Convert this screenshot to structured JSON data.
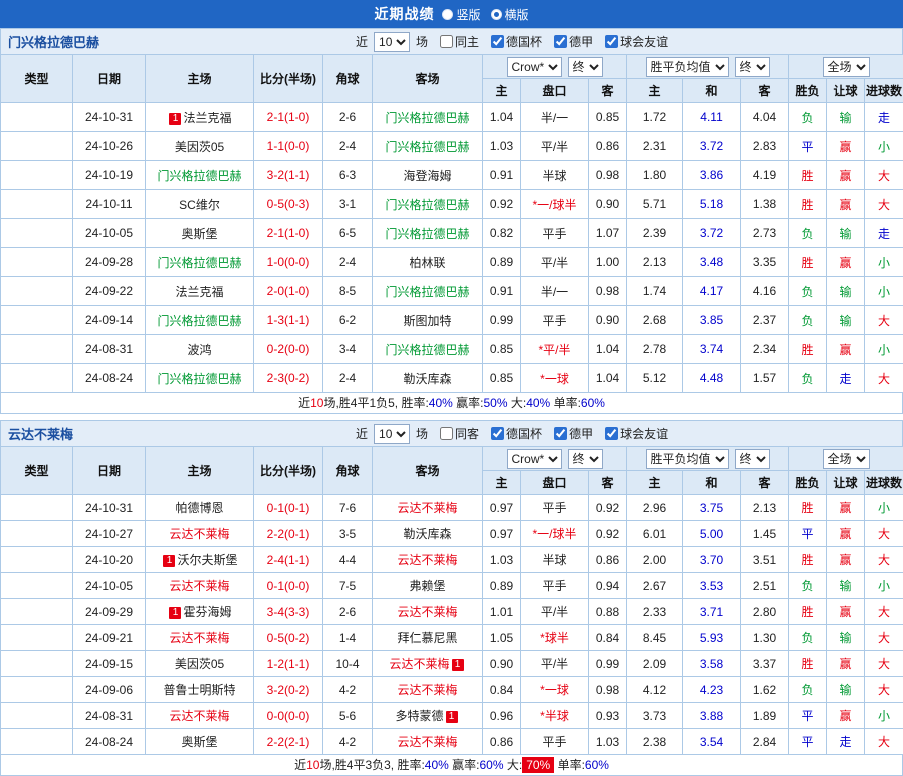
{
  "palette": {
    "topbar_bg": "#2066C4",
    "header_bg": "#DCE9F6",
    "bar_bg": "#E3EDF8",
    "border": "#ACC9E6",
    "red": "#E60012",
    "green": "#009933",
    "blue": "#0000CC",
    "title_blue": "#1B4FA0",
    "league_cup": "#CB4545",
    "league_bund": "#BB44C0",
    "league_friend": "#3AA6A8"
  },
  "top_bar": {
    "title": "近期战绩",
    "options": [
      {
        "label": "竖版",
        "selected": false
      },
      {
        "label": "横版",
        "selected": true
      }
    ]
  },
  "table_header": {
    "type": "类型",
    "date": "日期",
    "home": "主场",
    "score": "比分(半场)",
    "corner": "角球",
    "away": "客场",
    "select_company": "Crow*",
    "select_final": "终",
    "select_avg": "胜平负均值",
    "select_scope": "全场",
    "sub": [
      "主",
      "盘口",
      "客",
      "主",
      "和",
      "客",
      "胜负",
      "让球",
      "进球数"
    ]
  },
  "sections": [
    {
      "title": "门兴格拉德巴赫",
      "filter": {
        "near": "近",
        "count": "10",
        "games": "场",
        "same": "同主",
        "same_checked": false,
        "leagues": [
          {
            "label": "德国杯",
            "checked": true
          },
          {
            "label": "德甲",
            "checked": true
          },
          {
            "label": "球会友谊",
            "checked": true
          }
        ]
      },
      "rows": [
        {
          "league": "德国杯",
          "lg": "cup",
          "date": "24-10-31",
          "home": {
            "name": "法兰克福",
            "badge": "1",
            "badge_pos": "before"
          },
          "score": "2-1(1-0)",
          "corner": "2-6",
          "away": {
            "name": "门兴格拉德巴赫",
            "hl": "green"
          },
          "ah": [
            "1.04",
            "半/一",
            "0.85"
          ],
          "eu": [
            "1.72",
            "4.11",
            "4.04"
          ],
          "res": [
            [
              "负",
              "g"
            ],
            [
              "输",
              "g"
            ],
            [
              "走",
              "b"
            ]
          ]
        },
        {
          "league": "德甲",
          "lg": "bund",
          "date": "24-10-26",
          "home": {
            "name": "美因茨05"
          },
          "score": "1-1(0-0)",
          "corner": "2-4",
          "away": {
            "name": "门兴格拉德巴赫",
            "hl": "green"
          },
          "ah": [
            "1.03",
            "平/半",
            "0.86"
          ],
          "eu": [
            "2.31",
            "3.72",
            "2.83"
          ],
          "res": [
            [
              "平",
              "b"
            ],
            [
              "赢",
              "r"
            ],
            [
              "小",
              "g"
            ]
          ]
        },
        {
          "league": "德甲",
          "lg": "bund",
          "date": "24-10-19",
          "home": {
            "name": "门兴格拉德巴赫",
            "hl": "green"
          },
          "score": "3-2(1-1)",
          "corner": "6-3",
          "away": {
            "name": "海登海姆"
          },
          "ah": [
            "0.91",
            "半球",
            "0.98"
          ],
          "eu": [
            "1.80",
            "3.86",
            "4.19"
          ],
          "res": [
            [
              "胜",
              "r"
            ],
            [
              "赢",
              "r"
            ],
            [
              "大",
              "r"
            ]
          ]
        },
        {
          "league": "球会友谊",
          "lg": "friend",
          "date": "24-10-11",
          "home": {
            "name": "SC维尔"
          },
          "score": "0-5(0-3)",
          "corner": "3-1",
          "away": {
            "name": "门兴格拉德巴赫",
            "hl": "green"
          },
          "ah": [
            "0.92",
            "*一/球半",
            "0.90"
          ],
          "eu": [
            "5.71",
            "5.18",
            "1.38"
          ],
          "res": [
            [
              "胜",
              "r"
            ],
            [
              "赢",
              "r"
            ],
            [
              "大",
              "r"
            ]
          ]
        },
        {
          "league": "德甲",
          "lg": "bund",
          "date": "24-10-05",
          "home": {
            "name": "奥斯堡"
          },
          "score": "2-1(1-0)",
          "corner": "6-5",
          "away": {
            "name": "门兴格拉德巴赫",
            "hl": "green"
          },
          "ah": [
            "0.82",
            "平手",
            "1.07"
          ],
          "eu": [
            "2.39",
            "3.72",
            "2.73"
          ],
          "res": [
            [
              "负",
              "g"
            ],
            [
              "输",
              "g"
            ],
            [
              "走",
              "b"
            ]
          ]
        },
        {
          "league": "德甲",
          "lg": "bund",
          "date": "24-09-28",
          "home": {
            "name": "门兴格拉德巴赫",
            "hl": "green"
          },
          "score": "1-0(0-0)",
          "corner": "2-4",
          "away": {
            "name": "柏林联"
          },
          "ah": [
            "0.89",
            "平/半",
            "1.00"
          ],
          "eu": [
            "2.13",
            "3.48",
            "3.35"
          ],
          "res": [
            [
              "胜",
              "r"
            ],
            [
              "赢",
              "r"
            ],
            [
              "小",
              "g"
            ]
          ]
        },
        {
          "league": "德甲",
          "lg": "bund",
          "date": "24-09-22",
          "home": {
            "name": "法兰克福"
          },
          "score": "2-0(1-0)",
          "corner": "8-5",
          "away": {
            "name": "门兴格拉德巴赫",
            "hl": "green"
          },
          "ah": [
            "0.91",
            "半/一",
            "0.98"
          ],
          "eu": [
            "1.74",
            "4.17",
            "4.16"
          ],
          "res": [
            [
              "负",
              "g"
            ],
            [
              "输",
              "g"
            ],
            [
              "小",
              "g"
            ]
          ]
        },
        {
          "league": "德甲",
          "lg": "bund",
          "date": "24-09-14",
          "home": {
            "name": "门兴格拉德巴赫",
            "hl": "green"
          },
          "score": "1-3(1-1)",
          "corner": "6-2",
          "away": {
            "name": "斯图加特"
          },
          "ah": [
            "0.99",
            "平手",
            "0.90"
          ],
          "eu": [
            "2.68",
            "3.85",
            "2.37"
          ],
          "res": [
            [
              "负",
              "g"
            ],
            [
              "输",
              "g"
            ],
            [
              "大",
              "r"
            ]
          ]
        },
        {
          "league": "德甲",
          "lg": "bund",
          "date": "24-08-31",
          "home": {
            "name": "波鸿"
          },
          "score": "0-2(0-0)",
          "corner": "3-4",
          "away": {
            "name": "门兴格拉德巴赫",
            "hl": "green"
          },
          "ah": [
            "0.85",
            "*平/半",
            "1.04"
          ],
          "eu": [
            "2.78",
            "3.74",
            "2.34"
          ],
          "res": [
            [
              "胜",
              "r"
            ],
            [
              "赢",
              "r"
            ],
            [
              "小",
              "g"
            ]
          ]
        },
        {
          "league": "德甲",
          "lg": "bund",
          "date": "24-08-24",
          "home": {
            "name": "门兴格拉德巴赫",
            "hl": "green"
          },
          "score": "2-3(0-2)",
          "corner": "2-4",
          "away": {
            "name": "勒沃库森"
          },
          "ah": [
            "0.85",
            "*一球",
            "1.04"
          ],
          "eu": [
            "5.12",
            "4.48",
            "1.57"
          ],
          "res": [
            [
              "负",
              "g"
            ],
            [
              "走",
              "b"
            ],
            [
              "大",
              "r"
            ]
          ]
        }
      ],
      "summary": [
        [
          "近",
          "k"
        ],
        [
          "10",
          "r"
        ],
        [
          "场,胜4平1负5, 胜率:",
          "k"
        ],
        [
          "40%",
          "b"
        ],
        [
          " 赢率:",
          "k"
        ],
        [
          "50%",
          "b"
        ],
        [
          " 大:",
          "k"
        ],
        [
          "40%",
          "b"
        ],
        [
          " 单率:",
          "k"
        ],
        [
          "60%",
          "b"
        ]
      ]
    },
    {
      "title": "云达不莱梅",
      "filter": {
        "near": "近",
        "count": "10",
        "games": "场",
        "same": "同客",
        "same_checked": false,
        "leagues": [
          {
            "label": "德国杯",
            "checked": true
          },
          {
            "label": "德甲",
            "checked": true
          },
          {
            "label": "球会友谊",
            "checked": true
          }
        ]
      },
      "rows": [
        {
          "league": "德国杯",
          "lg": "cup",
          "date": "24-10-31",
          "home": {
            "name": "帕德博恩"
          },
          "score": "0-1(0-1)",
          "corner": "7-6",
          "away": {
            "name": "云达不莱梅",
            "hl": "red"
          },
          "ah": [
            "0.97",
            "平手",
            "0.92"
          ],
          "eu": [
            "2.96",
            "3.75",
            "2.13"
          ],
          "res": [
            [
              "胜",
              "r"
            ],
            [
              "赢",
              "r"
            ],
            [
              "小",
              "g"
            ]
          ]
        },
        {
          "league": "德甲",
          "lg": "bund",
          "date": "24-10-27",
          "home": {
            "name": "云达不莱梅",
            "hl": "red"
          },
          "score": "2-2(0-1)",
          "corner": "3-5",
          "away": {
            "name": "勒沃库森"
          },
          "ah": [
            "0.97",
            "*一/球半",
            "0.92"
          ],
          "eu": [
            "6.01",
            "5.00",
            "1.45"
          ],
          "res": [
            [
              "平",
              "b"
            ],
            [
              "赢",
              "r"
            ],
            [
              "大",
              "r"
            ]
          ]
        },
        {
          "league": "德甲",
          "lg": "bund",
          "date": "24-10-20",
          "home": {
            "name": "沃尔夫斯堡",
            "badge": "1",
            "badge_pos": "before"
          },
          "score": "2-4(1-1)",
          "corner": "4-4",
          "away": {
            "name": "云达不莱梅",
            "hl": "red"
          },
          "ah": [
            "1.03",
            "半球",
            "0.86"
          ],
          "eu": [
            "2.00",
            "3.70",
            "3.51"
          ],
          "res": [
            [
              "胜",
              "r"
            ],
            [
              "赢",
              "r"
            ],
            [
              "大",
              "r"
            ]
          ]
        },
        {
          "league": "德甲",
          "lg": "bund",
          "date": "24-10-05",
          "home": {
            "name": "云达不莱梅",
            "hl": "red"
          },
          "score": "0-1(0-0)",
          "corner": "7-5",
          "away": {
            "name": "弗赖堡"
          },
          "ah": [
            "0.89",
            "平手",
            "0.94"
          ],
          "eu": [
            "2.67",
            "3.53",
            "2.51"
          ],
          "res": [
            [
              "负",
              "g"
            ],
            [
              "输",
              "g"
            ],
            [
              "小",
              "g"
            ]
          ]
        },
        {
          "league": "德甲",
          "lg": "bund",
          "date": "24-09-29",
          "home": {
            "name": "霍芬海姆",
            "badge": "1",
            "badge_pos": "before"
          },
          "score": "3-4(3-3)",
          "corner": "2-6",
          "away": {
            "name": "云达不莱梅",
            "hl": "red"
          },
          "ah": [
            "1.01",
            "平/半",
            "0.88"
          ],
          "eu": [
            "2.33",
            "3.71",
            "2.80"
          ],
          "res": [
            [
              "胜",
              "r"
            ],
            [
              "赢",
              "r"
            ],
            [
              "大",
              "r"
            ]
          ]
        },
        {
          "league": "德甲",
          "lg": "bund",
          "date": "24-09-21",
          "home": {
            "name": "云达不莱梅",
            "hl": "red"
          },
          "score": "0-5(0-2)",
          "corner": "1-4",
          "away": {
            "name": "拜仁慕尼黑"
          },
          "ah": [
            "1.05",
            "*球半",
            "0.84"
          ],
          "eu": [
            "8.45",
            "5.93",
            "1.30"
          ],
          "res": [
            [
              "负",
              "g"
            ],
            [
              "输",
              "g"
            ],
            [
              "大",
              "r"
            ]
          ]
        },
        {
          "league": "德甲",
          "lg": "bund",
          "date": "24-09-15",
          "home": {
            "name": "美因茨05"
          },
          "score": "1-2(1-1)",
          "corner": "10-4",
          "away": {
            "name": "云达不莱梅",
            "hl": "red",
            "badge": "1",
            "badge_pos": "after"
          },
          "ah": [
            "0.90",
            "平/半",
            "0.99"
          ],
          "eu": [
            "2.09",
            "3.58",
            "3.37"
          ],
          "res": [
            [
              "胜",
              "r"
            ],
            [
              "赢",
              "r"
            ],
            [
              "大",
              "r"
            ]
          ]
        },
        {
          "league": "球会友谊",
          "lg": "friend",
          "date": "24-09-06",
          "home": {
            "name": "普鲁士明斯特"
          },
          "score": "3-2(0-2)",
          "corner": "4-2",
          "away": {
            "name": "云达不莱梅",
            "hl": "red"
          },
          "ah": [
            "0.84",
            "*一球",
            "0.98"
          ],
          "eu": [
            "4.12",
            "4.23",
            "1.62"
          ],
          "res": [
            [
              "负",
              "g"
            ],
            [
              "输",
              "g"
            ],
            [
              "大",
              "r"
            ]
          ]
        },
        {
          "league": "德甲",
          "lg": "bund",
          "date": "24-08-31",
          "home": {
            "name": "云达不莱梅",
            "hl": "red"
          },
          "score": "0-0(0-0)",
          "corner": "5-6",
          "away": {
            "name": "多特蒙德",
            "badge": "1",
            "badge_pos": "after"
          },
          "ah": [
            "0.96",
            "*半球",
            "0.93"
          ],
          "eu": [
            "3.73",
            "3.88",
            "1.89"
          ],
          "res": [
            [
              "平",
              "b"
            ],
            [
              "赢",
              "r"
            ],
            [
              "小",
              "g"
            ]
          ]
        },
        {
          "league": "德甲",
          "lg": "bund",
          "date": "24-08-24",
          "home": {
            "name": "奥斯堡"
          },
          "score": "2-2(2-1)",
          "corner": "4-2",
          "away": {
            "name": "云达不莱梅",
            "hl": "red"
          },
          "ah": [
            "0.86",
            "平手",
            "1.03"
          ],
          "eu": [
            "2.38",
            "3.54",
            "2.84"
          ],
          "res": [
            [
              "平",
              "b"
            ],
            [
              "走",
              "b"
            ],
            [
              "大",
              "r"
            ]
          ]
        }
      ],
      "summary": [
        [
          "近",
          "k"
        ],
        [
          "10",
          "r"
        ],
        [
          "场,胜4平3负3, 胜率:",
          "k"
        ],
        [
          "40%",
          "b"
        ],
        [
          " 赢率:",
          "k"
        ],
        [
          "60%",
          "b"
        ],
        [
          " 大:",
          "k"
        ],
        [
          "70%",
          "hl"
        ],
        [
          " 单率:",
          "k"
        ],
        [
          "60%",
          "b"
        ]
      ]
    }
  ]
}
